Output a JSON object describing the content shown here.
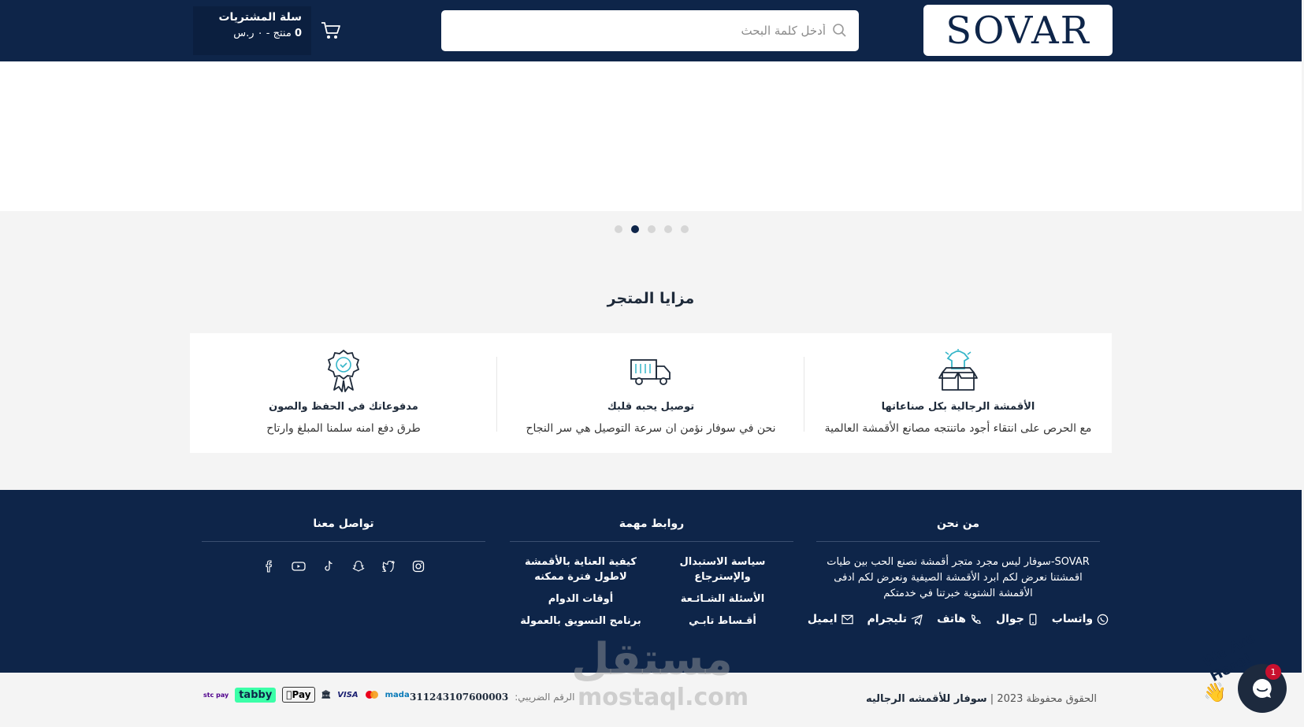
{
  "header": {
    "logo": "SOVAR",
    "search_placeholder": "أدخل كلمة البحث",
    "cart": {
      "title": "سلة المشتريات",
      "count": "0",
      "count_label": "منتج",
      "total": "- ٠ ر.س"
    }
  },
  "slider": {
    "dots": 5,
    "active_index": 1
  },
  "features": {
    "title": "مزايا المتجر",
    "items": [
      {
        "icon": "shirt-box-icon",
        "title": "الأقمشة الرجالية بكل صناعاتها",
        "desc": "مع الحرص على انتقاء أجود ماتنتجه مصانع الأقمشة العالمية"
      },
      {
        "icon": "delivery-truck-icon",
        "title": "توصيل يحبه قلبك",
        "desc": "نحن في سوفار نؤمن ان سرعة التوصيل هي سر النجاح"
      },
      {
        "icon": "quality-badge-icon",
        "title": "مدفوعاتك في الحفظ والصون",
        "desc": "طرق دفع امنه سلمنا المبلغ وارتاح"
      }
    ]
  },
  "footer": {
    "about": {
      "title": "من نحن",
      "text": "SOVAR-سوفار ليس مجرد متجر أقمشة نصنع الحب بين طيات اقمشتنا نعرض لكم ابرد الأقمشة الصيفية ونعرض لكم ادفى الأقمشة الشتوية خبرتنا في خدمتكم",
      "contacts": [
        "واتساب",
        "جوال",
        "هاتف",
        "تليجرام",
        "ايميل"
      ]
    },
    "links": {
      "title": "روابط مهمة",
      "col1": [
        "سياسة الاستبدال والإسترجاع",
        "الأسئلة الشـائـعة",
        "أقـساط تابـي"
      ],
      "col2": [
        "كيفية العناية بالأقمشة لاطول فترة ممكنه",
        "أوقات الدوام",
        "برنامج التسويق بالعمولة"
      ]
    },
    "social": {
      "title": "تواصل معنا",
      "icons": [
        "instagram-icon",
        "twitter-icon",
        "snapchat-icon",
        "tiktok-icon",
        "youtube-icon",
        "facebook-icon"
      ]
    }
  },
  "bottom": {
    "rights": "الحقوق محفوظة",
    "year": "2023",
    "separator": "|",
    "store": "سوفار للأقمشه الرجاليه",
    "tax_label": "الرقم الضريبي:",
    "tax_number": "311243107600003",
    "payments": [
      "mada",
      "VISA",
      "bank",
      "Pay",
      "tabby",
      "stc pay"
    ]
  },
  "watermark": {
    "text": "مستقل",
    "sub": "mostaql.com"
  },
  "chat": {
    "badge": "We Are Here!",
    "unread": "1"
  }
}
